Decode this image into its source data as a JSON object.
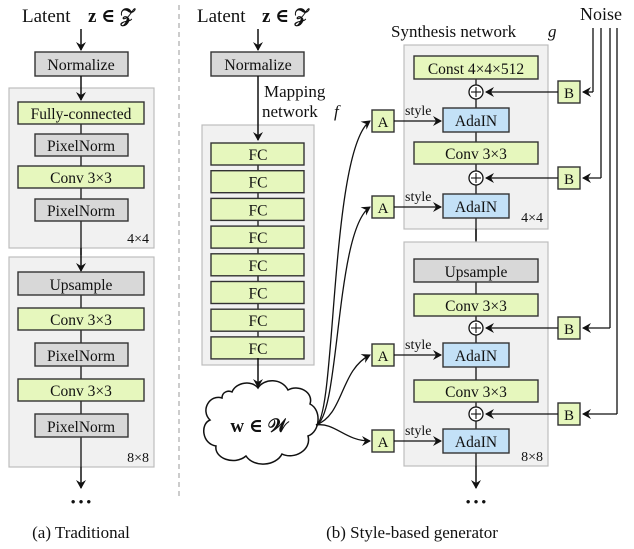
{
  "traditional": {
    "input_label": "Latent",
    "input_math": "z ∈ 𝒵",
    "normalize": "Normalize",
    "block1": {
      "layers": [
        "Fully-connected",
        "PixelNorm",
        "Conv 3×3",
        "PixelNorm"
      ],
      "resolution": "4×4"
    },
    "block2": {
      "layers": [
        "Upsample",
        "Conv 3×3",
        "PixelNorm",
        "Conv 3×3",
        "PixelNorm"
      ],
      "resolution": "8×8"
    },
    "ellipsis": "• • •",
    "caption": "(a) Traditional"
  },
  "style_based": {
    "input_label": "Latent",
    "input_math": "z ∈ 𝒵",
    "normalize": "Normalize",
    "mapping_label_line1": "Mapping",
    "mapping_label_line2": "network",
    "mapping_symbol": "f",
    "mapping_layers": [
      "FC",
      "FC",
      "FC",
      "FC",
      "FC",
      "FC",
      "FC",
      "FC"
    ],
    "w_label": "w ∈ 𝒲",
    "synthesis_label": "Synthesis network",
    "synthesis_symbol": "g",
    "noise_label": "Noise",
    "affine_label": "A",
    "noise_scale_label": "B",
    "style_label": "style",
    "plus_symbol": "+",
    "block1": {
      "const": "Const 4×4×512",
      "adain": "AdaIN",
      "conv": "Conv 3×3",
      "resolution": "4×4"
    },
    "block2": {
      "upsample": "Upsample",
      "conv": "Conv 3×3",
      "adain": "AdaIN",
      "resolution": "8×8"
    },
    "ellipsis": "• • •",
    "caption": "(b) Style-based generator"
  }
}
